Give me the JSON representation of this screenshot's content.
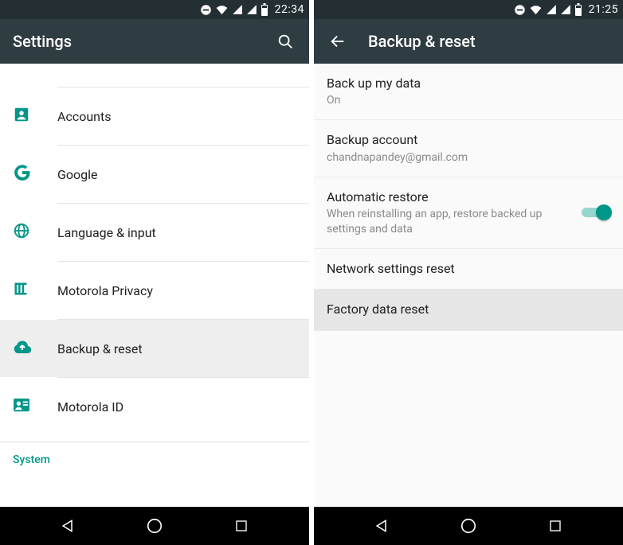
{
  "colors": {
    "accent": "#009688",
    "appbar": "#2f3d42",
    "statusbar": "#242f33"
  },
  "left": {
    "status": {
      "time": "22:34"
    },
    "appbar": {
      "title": "Settings"
    },
    "items": [
      {
        "icon": "accounts-icon",
        "label": "Accounts"
      },
      {
        "icon": "google-icon",
        "label": "Google"
      },
      {
        "icon": "language-icon",
        "label": "Language & input"
      },
      {
        "icon": "privacy-icon",
        "label": "Motorola Privacy"
      },
      {
        "icon": "backup-icon",
        "label": "Backup & reset",
        "selected": true
      },
      {
        "icon": "id-icon",
        "label": "Motorola ID"
      }
    ],
    "section_label": "System"
  },
  "right": {
    "status": {
      "time": "21:25"
    },
    "appbar": {
      "title": "Backup & reset"
    },
    "items": [
      {
        "title": "Back up my data",
        "subtitle": "On"
      },
      {
        "title": "Backup account",
        "subtitle": "chandnapandey@gmail.com"
      },
      {
        "title": "Automatic restore",
        "subtitle": "When reinstalling an app, restore backed up settings and data",
        "toggle": true
      },
      {
        "title": "Network settings reset"
      },
      {
        "title": "Factory data reset",
        "highlight": true
      }
    ]
  }
}
